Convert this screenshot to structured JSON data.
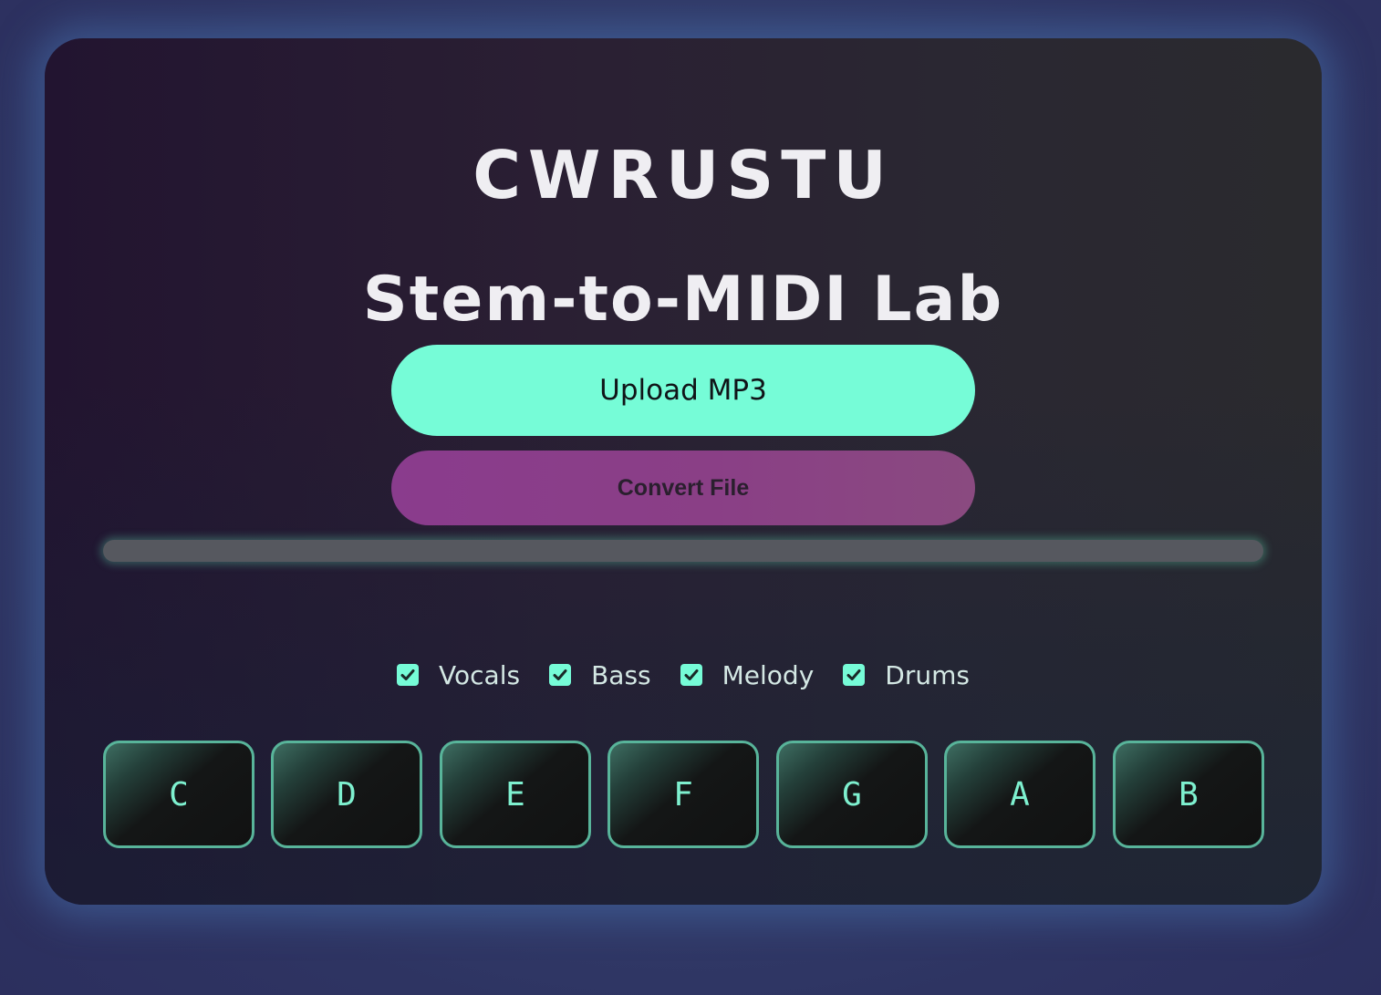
{
  "header": {
    "brand": "CWRUSTU",
    "title": "Stem-to-MIDI Lab"
  },
  "actions": {
    "upload_label": "Upload MP3",
    "convert_label": "Convert File"
  },
  "progress": {
    "value": 0
  },
  "stems": [
    {
      "label": "Vocals",
      "checked": true
    },
    {
      "label": "Bass",
      "checked": true
    },
    {
      "label": "Melody",
      "checked": true
    },
    {
      "label": "Drums",
      "checked": true
    }
  ],
  "keys": [
    "C",
    "D",
    "E",
    "F",
    "G",
    "A",
    "B"
  ],
  "colors": {
    "accent": "#76fcd7",
    "convert": "#8a3f86",
    "key_border": "#58b49a"
  }
}
